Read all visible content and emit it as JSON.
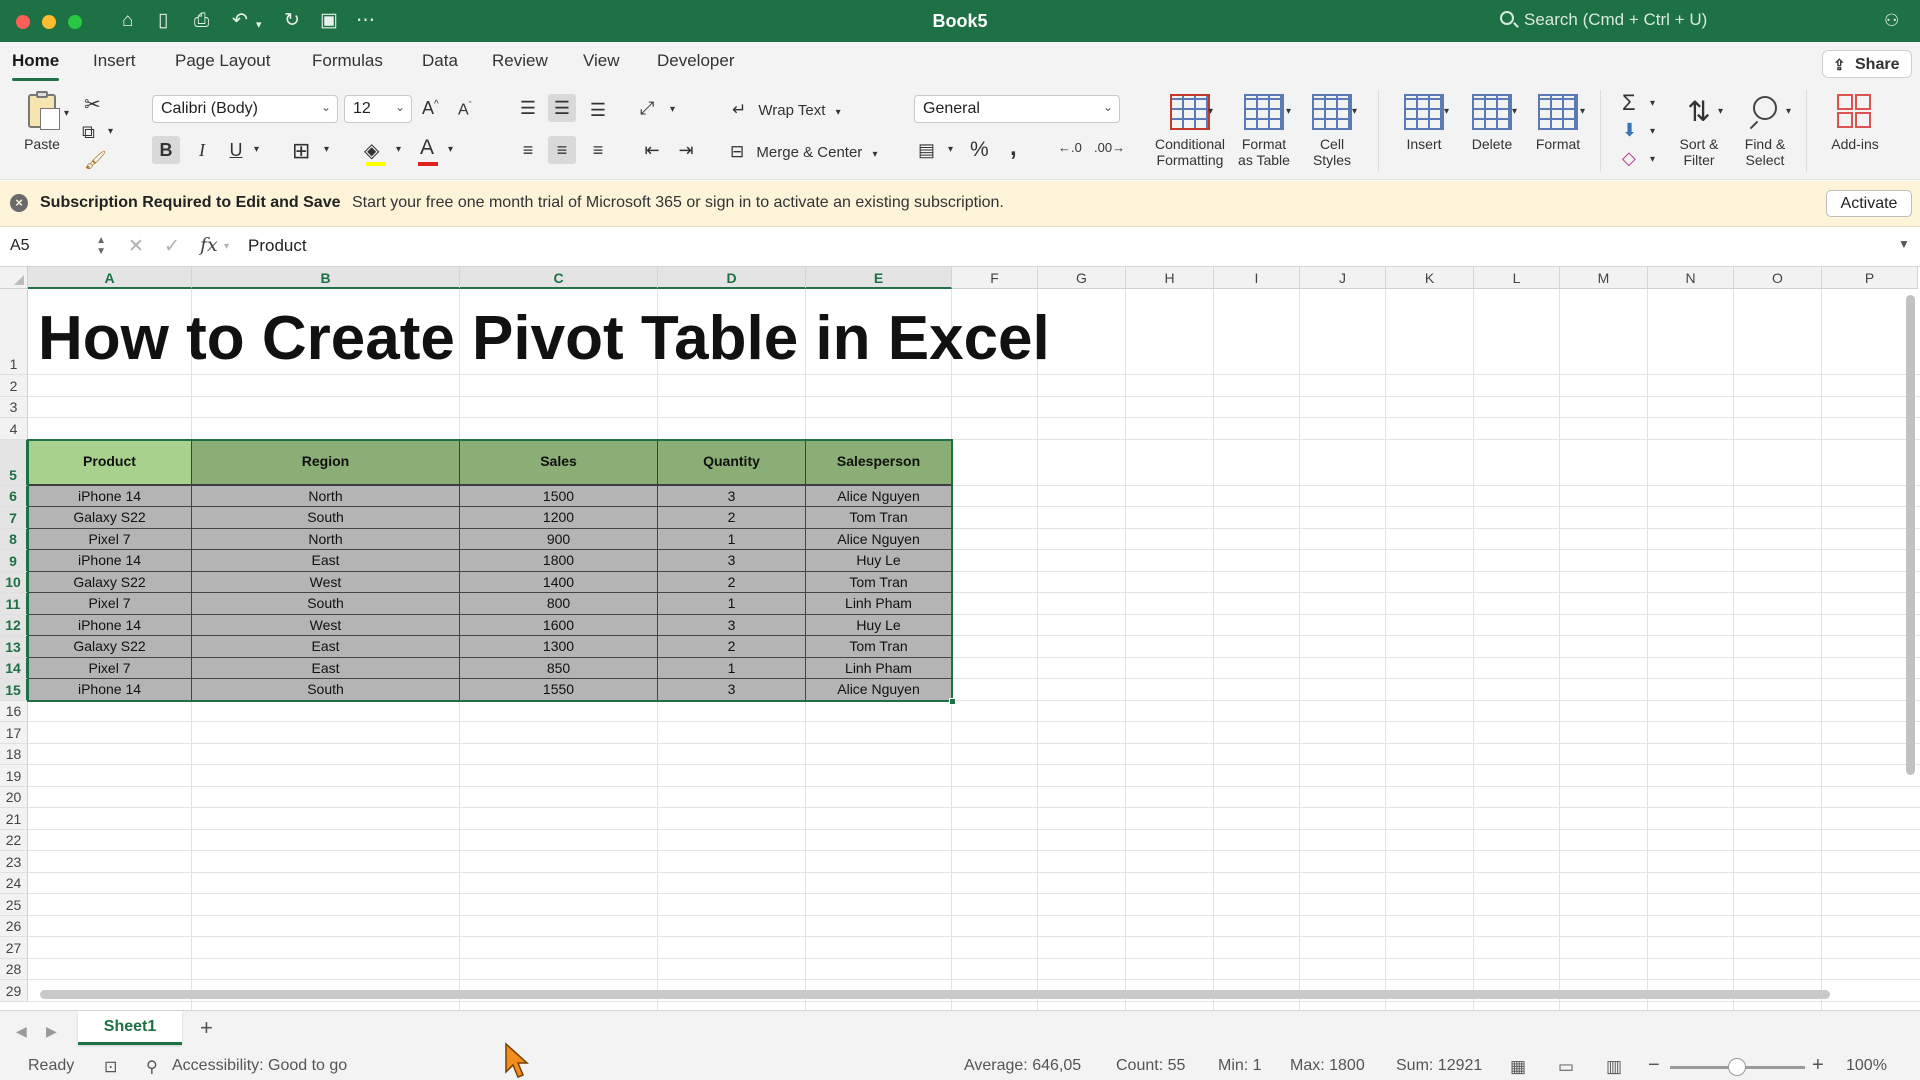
{
  "window": {
    "title": "Book5",
    "search_placeholder": "Search (Cmd + Ctrl + U)"
  },
  "ribbon_tabs": [
    "Home",
    "Insert",
    "Page Layout",
    "Formulas",
    "Data",
    "Review",
    "View",
    "Developer"
  ],
  "active_tab": "Home",
  "share_label": "Share",
  "ribbon": {
    "paste_label": "Paste",
    "font_name": "Calibri (Body)",
    "font_size": "12",
    "bold": "B",
    "italic": "I",
    "underline": "U",
    "wrap_text": "Wrap Text",
    "merge_center": "Merge & Center",
    "number_format": "General",
    "percent": "%",
    "comma": ",",
    "conditional_formatting": [
      "Conditional",
      "Formatting"
    ],
    "format_as_table": [
      "Format",
      "as Table"
    ],
    "cell_styles": [
      "Cell",
      "Styles"
    ],
    "insert": "Insert",
    "delete": "Delete",
    "format": "Format",
    "sort_filter": [
      "Sort &",
      "Filter"
    ],
    "find_select": [
      "Find &",
      "Select"
    ],
    "add_ins": "Add-ins"
  },
  "message_bar": {
    "title": "Subscription Required to Edit and Save",
    "text": "Start your free one month trial of Microsoft 365 or sign in to activate an existing subscription.",
    "button": "Activate"
  },
  "formula_bar": {
    "name_box": "A5",
    "fx": "fx",
    "content": "Product"
  },
  "columns": [
    "A",
    "B",
    "C",
    "D",
    "E",
    "F",
    "G",
    "H",
    "I",
    "J",
    "K",
    "L",
    "M",
    "N",
    "O",
    "P"
  ],
  "selected_columns": [
    "A",
    "B",
    "C",
    "D",
    "E"
  ],
  "sheet_title": "How to Create Pivot Table in Excel",
  "table": {
    "headers": [
      "Product",
      "Region",
      "Sales",
      "Quantity",
      "Salesperson"
    ],
    "rows": [
      [
        "iPhone 14",
        "North",
        "1500",
        "3",
        "Alice Nguyen"
      ],
      [
        "Galaxy S22",
        "South",
        "1200",
        "2",
        "Tom Tran"
      ],
      [
        "Pixel 7",
        "North",
        "900",
        "1",
        "Alice Nguyen"
      ],
      [
        "iPhone 14",
        "East",
        "1800",
        "3",
        "Huy Le"
      ],
      [
        "Galaxy S22",
        "West",
        "1400",
        "2",
        "Tom Tran"
      ],
      [
        "Pixel 7",
        "South",
        "800",
        "1",
        "Linh Pham"
      ],
      [
        "iPhone 14",
        "West",
        "1600",
        "3",
        "Huy Le"
      ],
      [
        "Galaxy S22",
        "East",
        "1300",
        "2",
        "Tom Tran"
      ],
      [
        "Pixel 7",
        "East",
        "850",
        "1",
        "Linh Pham"
      ],
      [
        "iPhone 14",
        "South",
        "1550",
        "3",
        "Alice Nguyen"
      ]
    ]
  },
  "sheet_tabs": [
    "Sheet1"
  ],
  "add_sheet": "+",
  "status": {
    "ready": "Ready",
    "accessibility": "Accessibility: Good to go",
    "average": "Average: 646,05",
    "count": "Count: 55",
    "min": "Min: 1",
    "max": "Max: 1800",
    "sum": "Sum: 12921",
    "zoom": "100%"
  },
  "colors": {
    "excel_green": "#1e7145",
    "header_fill": "#a9d18e",
    "data_fill": "#b4b4b4",
    "message_bg": "#fcf3d9"
  }
}
